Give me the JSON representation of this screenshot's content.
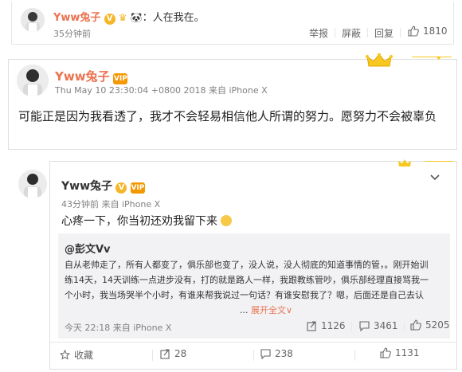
{
  "comment_top": {
    "username": "Yww兔子",
    "text": "：人在我在。",
    "time": "35分钟前",
    "actions": {
      "report": "举报",
      "block": "屏蔽",
      "reply": "回复",
      "likes": "1810"
    }
  },
  "post": {
    "username": "Yww兔子",
    "timestamp": "Thu May 10 23:30:04 +0800 2018 来自 iPhone X",
    "body": "可能正是因为我看透了，我才不会轻易相信他人所谓的努力。愿努力不会被辜负"
  },
  "weibo": {
    "username": "Yww兔子",
    "time_source": "43分钟前 来自 iPhone X",
    "text": "心疼一下，你当初还劝我留下来",
    "quote": {
      "author": "@彭文Vv",
      "text": "自从老帅走了，所有人都变了，俱乐部也变了，没人说，没人彻底的知道事情的管，。刚开始训练14天，14天训练一点进步没有，打的就是路人一样，我跟教练管吵，俱乐部经理直接骂我一个小时，我当场哭半个小时，有谁来帮我说过一句话？有谁安慰我了？嗯，后面还是自己去认错，说我不认错就别想上场打比赛，",
      "expand": "展开全文",
      "meta": "今天 22:18 来自 iPhone X",
      "reposts": "1126",
      "comments": "3461",
      "likes": "5205"
    },
    "footer": {
      "favorite": "收藏",
      "reposts": "28",
      "comments": "238",
      "likes": "1131"
    }
  },
  "colors": {
    "accent": "#eb7350",
    "gold": "#f6b628",
    "quote_bg": "#f2f2f5",
    "border": "#e6e6e6"
  }
}
